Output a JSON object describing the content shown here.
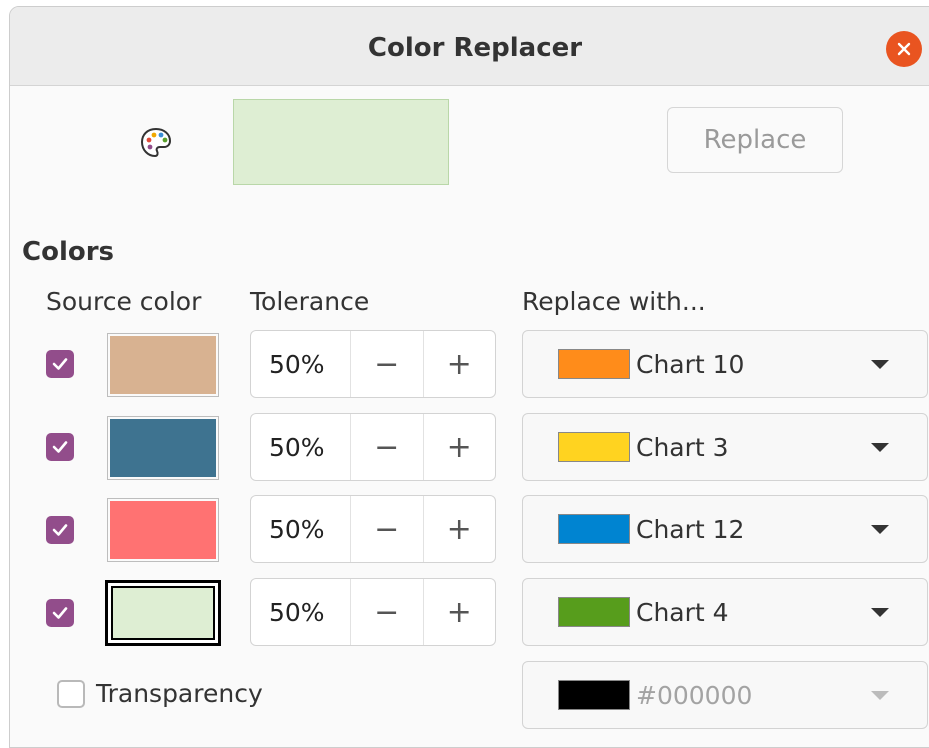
{
  "window": {
    "title": "Color Replacer"
  },
  "toolbar": {
    "replace_label": "Replace"
  },
  "section_label": "Colors",
  "columns": {
    "source": "Source color",
    "tolerance": "Tolerance",
    "replace_with": "Replace with..."
  },
  "rows": [
    {
      "checked": true,
      "source_color": "#d8b291",
      "tolerance": "50%",
      "replace_label": "Chart 10",
      "replace_color": "#ff8c1a"
    },
    {
      "checked": true,
      "source_color": "#3e7390",
      "tolerance": "50%",
      "replace_label": "Chart 3",
      "replace_color": "#ffd320"
    },
    {
      "checked": true,
      "source_color": "#ff7272",
      "tolerance": "50%",
      "replace_label": "Chart 12",
      "replace_color": "#0084d1"
    },
    {
      "checked": true,
      "source_color": "#deeed3",
      "tolerance": "50%",
      "replace_label": "Chart 4",
      "replace_color": "#579d1c"
    }
  ],
  "transparency": {
    "label": "Transparency",
    "checked": false,
    "value": "#000000",
    "color": "#000000"
  },
  "preview_color": "#deeed3",
  "icons": {
    "close": "close-icon",
    "palette": "palette-icon",
    "check": "check-icon",
    "caret": "caret-down-icon"
  }
}
